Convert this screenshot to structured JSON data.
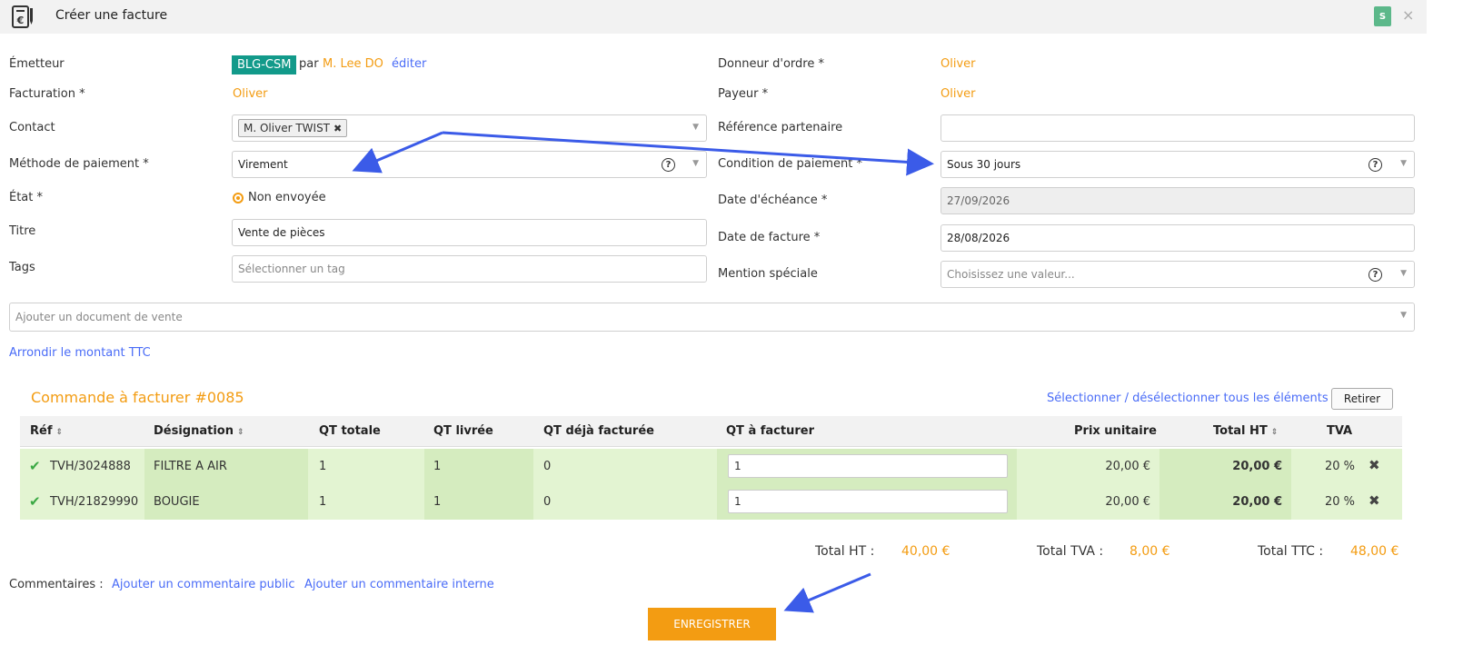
{
  "header": {
    "title": "Créer une facture",
    "badge": "S",
    "close": "×"
  },
  "form": {
    "emetteur": {
      "label": "Émetteur",
      "badge": "BLG-CSM",
      "by": "par",
      "person": "M. Lee DO",
      "edit": "éditer"
    },
    "facturation": {
      "label": "Facturation *",
      "value": "Oliver"
    },
    "contact": {
      "label": "Contact",
      "chip": "M. Oliver TWIST"
    },
    "methode": {
      "label": "Méthode de paiement *",
      "value": "Virement"
    },
    "etat": {
      "label": "État *",
      "value": "Non envoyée"
    },
    "titre": {
      "label": "Titre",
      "value": "Vente de pièces"
    },
    "tags": {
      "label": "Tags",
      "placeholder": "Sélectionner un tag"
    },
    "donneur": {
      "label": "Donneur d'ordre *",
      "value": "Oliver"
    },
    "payeur": {
      "label": "Payeur *",
      "value": "Oliver"
    },
    "reference": {
      "label": "Référence partenaire",
      "value": ""
    },
    "condition": {
      "label": "Condition de paiement *",
      "value": "Sous 30 jours"
    },
    "echeance": {
      "label": "Date d'échéance *",
      "value": "27/09/2026"
    },
    "date_facture": {
      "label": "Date de facture *",
      "value": "28/08/2026"
    },
    "mention": {
      "label": "Mention spéciale",
      "placeholder": "Choisissez une valeur..."
    },
    "document_vente": {
      "placeholder": "Ajouter un document de vente"
    },
    "arrondir": "Arrondir le montant TTC"
  },
  "order": {
    "title": "Commande à facturer #0085",
    "select_all": "Sélectionner / désélectionner tous les éléments",
    "remove": "Retirer",
    "columns": {
      "ref": "Réf",
      "designation": "Désignation",
      "qt_totale": "QT totale",
      "qt_livree": "QT livrée",
      "qt_deja": "QT déjà facturée",
      "qt_a_facturer": "QT à facturer",
      "prix_unitaire": "Prix unitaire",
      "total_ht": "Total HT",
      "tva": "TVA"
    },
    "rows": [
      {
        "ref": "TVH/3024888",
        "designation": "FILTRE A AIR",
        "qt_totale": "1",
        "qt_livree": "1",
        "qt_deja": "0",
        "qt_a_facturer": "1",
        "prix_unitaire": "20,00 €",
        "total_ht": "20,00 €",
        "tva": "20 %"
      },
      {
        "ref": "TVH/21829990",
        "designation": "BOUGIE",
        "qt_totale": "1",
        "qt_livree": "1",
        "qt_deja": "0",
        "qt_a_facturer": "1",
        "prix_unitaire": "20,00 €",
        "total_ht": "20,00 €",
        "tva": "20 %"
      }
    ]
  },
  "totals": {
    "ht_label": "Total HT :",
    "ht_value": "40,00 €",
    "tva_label": "Total TVA :",
    "tva_value": "8,00 €",
    "ttc_label": "Total TTC :",
    "ttc_value": "48,00 €"
  },
  "comments": {
    "label": "Commentaires :",
    "public": "Ajouter un commentaire public",
    "internal": "Ajouter un commentaire interne"
  },
  "save": "ENREGISTRER",
  "colors": {
    "accent": "#f39c12",
    "link": "#4a6cf7",
    "badge": "#129a8a",
    "row": "#e3f4d2",
    "annotation": "#3b5be8"
  }
}
